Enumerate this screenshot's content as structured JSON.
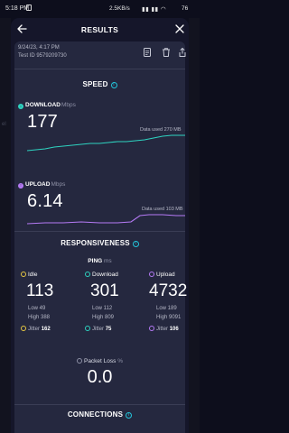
{
  "status": {
    "time": "5:18 PM",
    "rate": "2.5KB/s",
    "battery": "76"
  },
  "background": {
    "left_text": "el"
  },
  "header": {
    "title": "RESULTS"
  },
  "meta": {
    "date": "9/24/23, 4:17 PM",
    "test_id": "Test ID 9579209730"
  },
  "speed": {
    "title": "SPEED",
    "download": {
      "label": "DOWNLOAD",
      "unit": "Mbps",
      "value": "177",
      "data_used": "Data used 270 MB",
      "color": "#2ed3c0"
    },
    "upload": {
      "label": "UPLOAD",
      "unit": "Mbps",
      "value": "6.14",
      "data_used": "Data used 103 MB",
      "color": "#b57af5"
    }
  },
  "responsiveness": {
    "title": "RESPONSIVENESS",
    "ping_label": "PING",
    "ping_unit": "ms",
    "columns": [
      {
        "name": "Idle",
        "value": "113",
        "low": "Low 49",
        "high": "High 388",
        "jitter_label": "Jitter",
        "jitter": "162",
        "color": "#e7c843"
      },
      {
        "name": "Download",
        "value": "301",
        "low": "Low 112",
        "high": "High 809",
        "jitter_label": "Jitter",
        "jitter": "75",
        "color": "#2ed3c0"
      },
      {
        "name": "Upload",
        "value": "4732",
        "low": "Low 189",
        "high": "High 9091",
        "jitter_label": "Jitter",
        "jitter": "106",
        "color": "#b57af5"
      }
    ],
    "packet_loss_label": "Packet Loss",
    "packet_loss_unit": "%",
    "packet_loss": "0.0"
  },
  "connections": {
    "title": "CONNECTIONS"
  }
}
